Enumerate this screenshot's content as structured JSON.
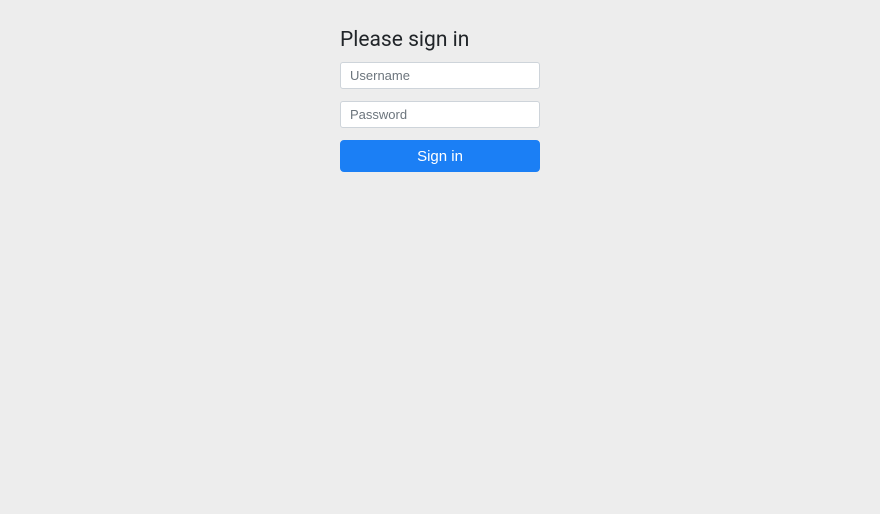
{
  "login": {
    "heading": "Please sign in",
    "username_placeholder": "Username",
    "password_placeholder": "Password",
    "submit_label": "Sign in"
  }
}
